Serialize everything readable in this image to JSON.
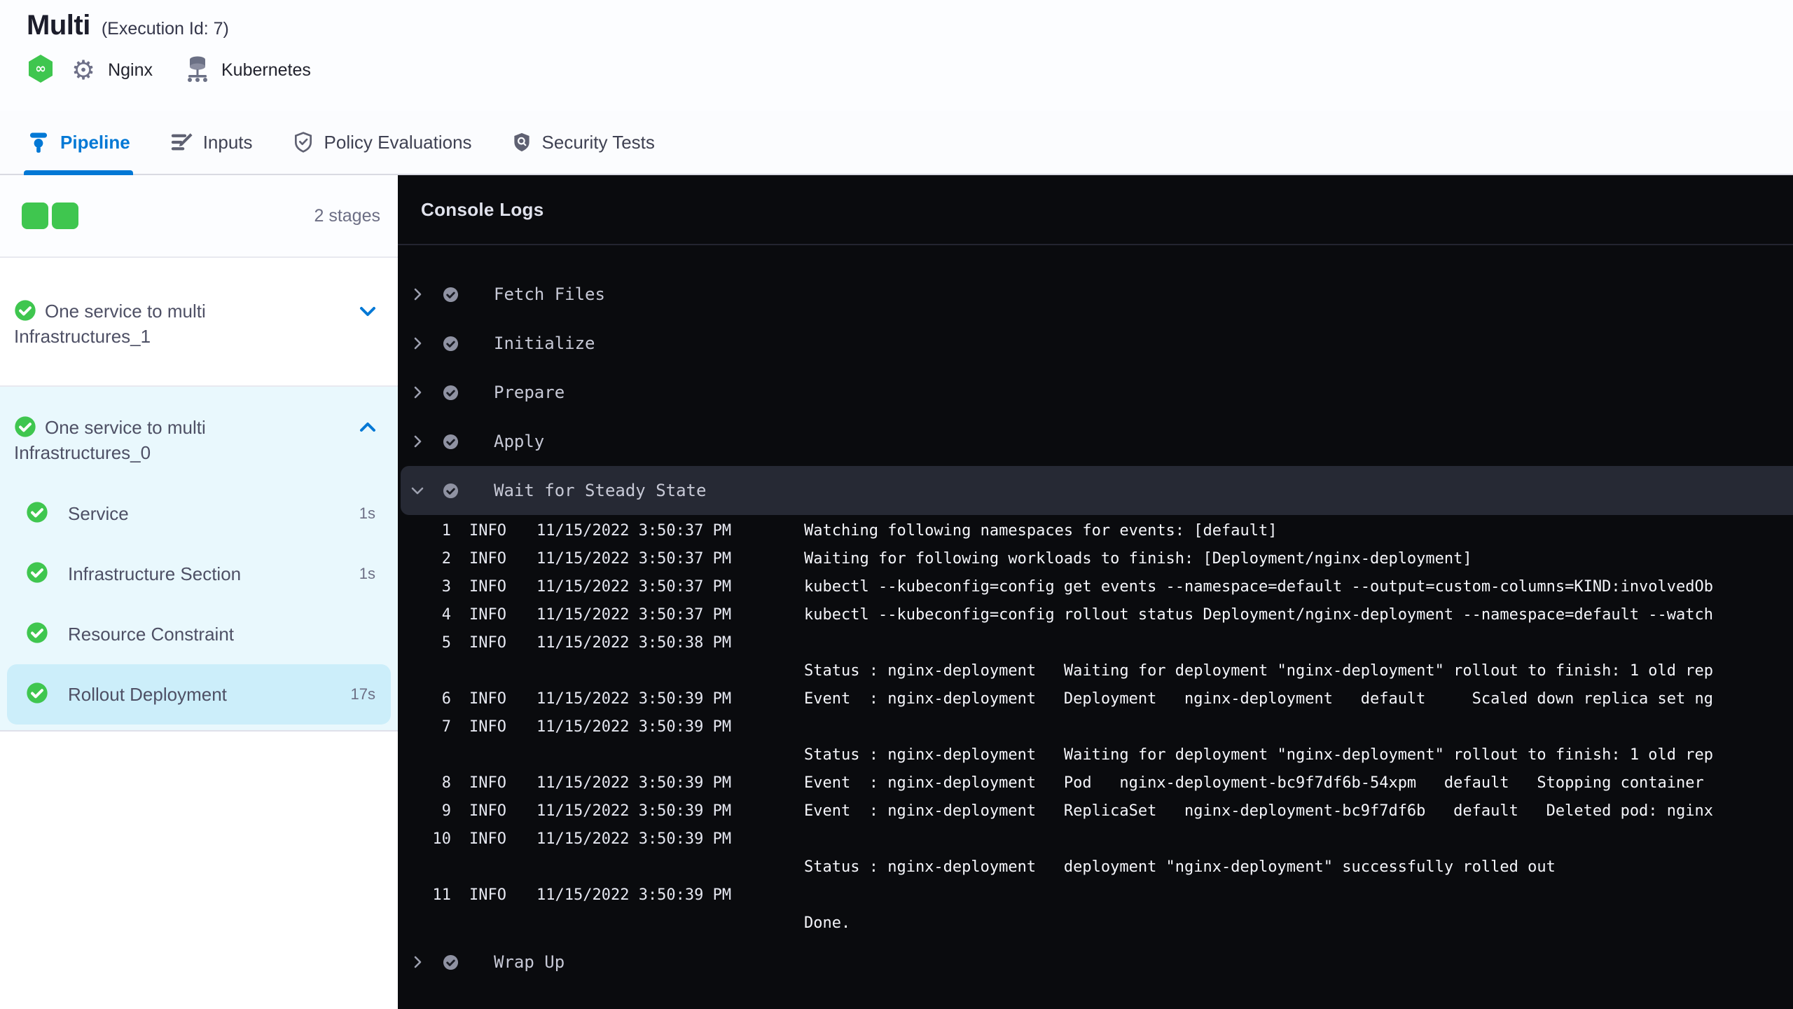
{
  "colors": {
    "accent_blue": "#0278d5",
    "success_green": "#3fc64f",
    "stage_bg": "#e9f8fd",
    "stage_selected_bg": "#cceefa",
    "console_bg": "#0a0b0e",
    "console_row_highlight": "#262934"
  },
  "header": {
    "title": "Multi",
    "execution_id": "(Execution Id: 7)",
    "service_label": "Nginx",
    "infrastructure_label": "Kubernetes"
  },
  "tabs": [
    {
      "label": "Pipeline",
      "icon": "pipeline",
      "active": true
    },
    {
      "label": "Inputs",
      "icon": "inputs",
      "active": false
    },
    {
      "label": "Policy Evaluations",
      "icon": "policy-shield-check",
      "active": false
    },
    {
      "label": "Security Tests",
      "icon": "security-shield-search",
      "active": false
    }
  ],
  "sidebar": {
    "stage_count_label": "2 stages",
    "stage_square_count": 2,
    "stages": [
      {
        "name": "One service to multi Infrastructures_1",
        "status": "success",
        "expanded": false,
        "steps": []
      },
      {
        "name": "One service to multi Infrastructures_0",
        "status": "success",
        "expanded": true,
        "steps": [
          {
            "label": "Service",
            "duration": "1s",
            "status": "success",
            "selected": false
          },
          {
            "label": "Infrastructure Section",
            "duration": "1s",
            "status": "success",
            "selected": false
          },
          {
            "label": "Resource Constraint",
            "duration": "",
            "status": "success",
            "selected": false
          },
          {
            "label": "Rollout Deployment",
            "duration": "17s",
            "status": "success",
            "selected": true
          }
        ]
      }
    ]
  },
  "console": {
    "title": "Console Logs",
    "steps": [
      {
        "label": "Fetch Files",
        "status": "success",
        "expanded": false
      },
      {
        "label": "Initialize",
        "status": "success",
        "expanded": false
      },
      {
        "label": "Prepare",
        "status": "success",
        "expanded": false
      },
      {
        "label": "Apply",
        "status": "success",
        "expanded": false
      },
      {
        "label": "Wait for Steady State",
        "status": "success",
        "expanded": true
      },
      {
        "label": "Wrap Up",
        "status": "success",
        "expanded": false
      }
    ],
    "logs": [
      {
        "n": "1",
        "level": "INFO",
        "time": "11/15/2022 3:50:37 PM",
        "msg": "Watching following namespaces for events: [default]"
      },
      {
        "n": "2",
        "level": "INFO",
        "time": "11/15/2022 3:50:37 PM",
        "msg": "Waiting for following workloads to finish: [Deployment/nginx-deployment]"
      },
      {
        "n": "3",
        "level": "INFO",
        "time": "11/15/2022 3:50:37 PM",
        "msg": "kubectl --kubeconfig=config get events --namespace=default --output=custom-columns=KIND:involvedOb"
      },
      {
        "n": "4",
        "level": "INFO",
        "time": "11/15/2022 3:50:37 PM",
        "msg": "kubectl --kubeconfig=config rollout status Deployment/nginx-deployment --namespace=default --watch"
      },
      {
        "n": "5",
        "level": "INFO",
        "time": "11/15/2022 3:50:38 PM",
        "msg": ""
      },
      {
        "n": "",
        "level": "",
        "time": "",
        "msg": "Status : nginx-deployment   Waiting for deployment \"nginx-deployment\" rollout to finish: 1 old rep"
      },
      {
        "n": "6",
        "level": "INFO",
        "time": "11/15/2022 3:50:39 PM",
        "msg": "Event  : nginx-deployment   Deployment   nginx-deployment   default     Scaled down replica set ng"
      },
      {
        "n": "7",
        "level": "INFO",
        "time": "11/15/2022 3:50:39 PM",
        "msg": ""
      },
      {
        "n": "",
        "level": "",
        "time": "",
        "msg": "Status : nginx-deployment   Waiting for deployment \"nginx-deployment\" rollout to finish: 1 old rep"
      },
      {
        "n": "8",
        "level": "INFO",
        "time": "11/15/2022 3:50:39 PM",
        "msg": "Event  : nginx-deployment   Pod   nginx-deployment-bc9f7df6b-54xpm   default   Stopping container"
      },
      {
        "n": "9",
        "level": "INFO",
        "time": "11/15/2022 3:50:39 PM",
        "msg": "Event  : nginx-deployment   ReplicaSet   nginx-deployment-bc9f7df6b   default   Deleted pod: nginx"
      },
      {
        "n": "10",
        "level": "INFO",
        "time": "11/15/2022 3:50:39 PM",
        "msg": ""
      },
      {
        "n": "",
        "level": "",
        "time": "",
        "msg": "Status : nginx-deployment   deployment \"nginx-deployment\" successfully rolled out"
      },
      {
        "n": "11",
        "level": "INFO",
        "time": "11/15/2022 3:50:39 PM",
        "msg": ""
      },
      {
        "n": "",
        "level": "",
        "time": "",
        "msg": "Done."
      }
    ]
  }
}
